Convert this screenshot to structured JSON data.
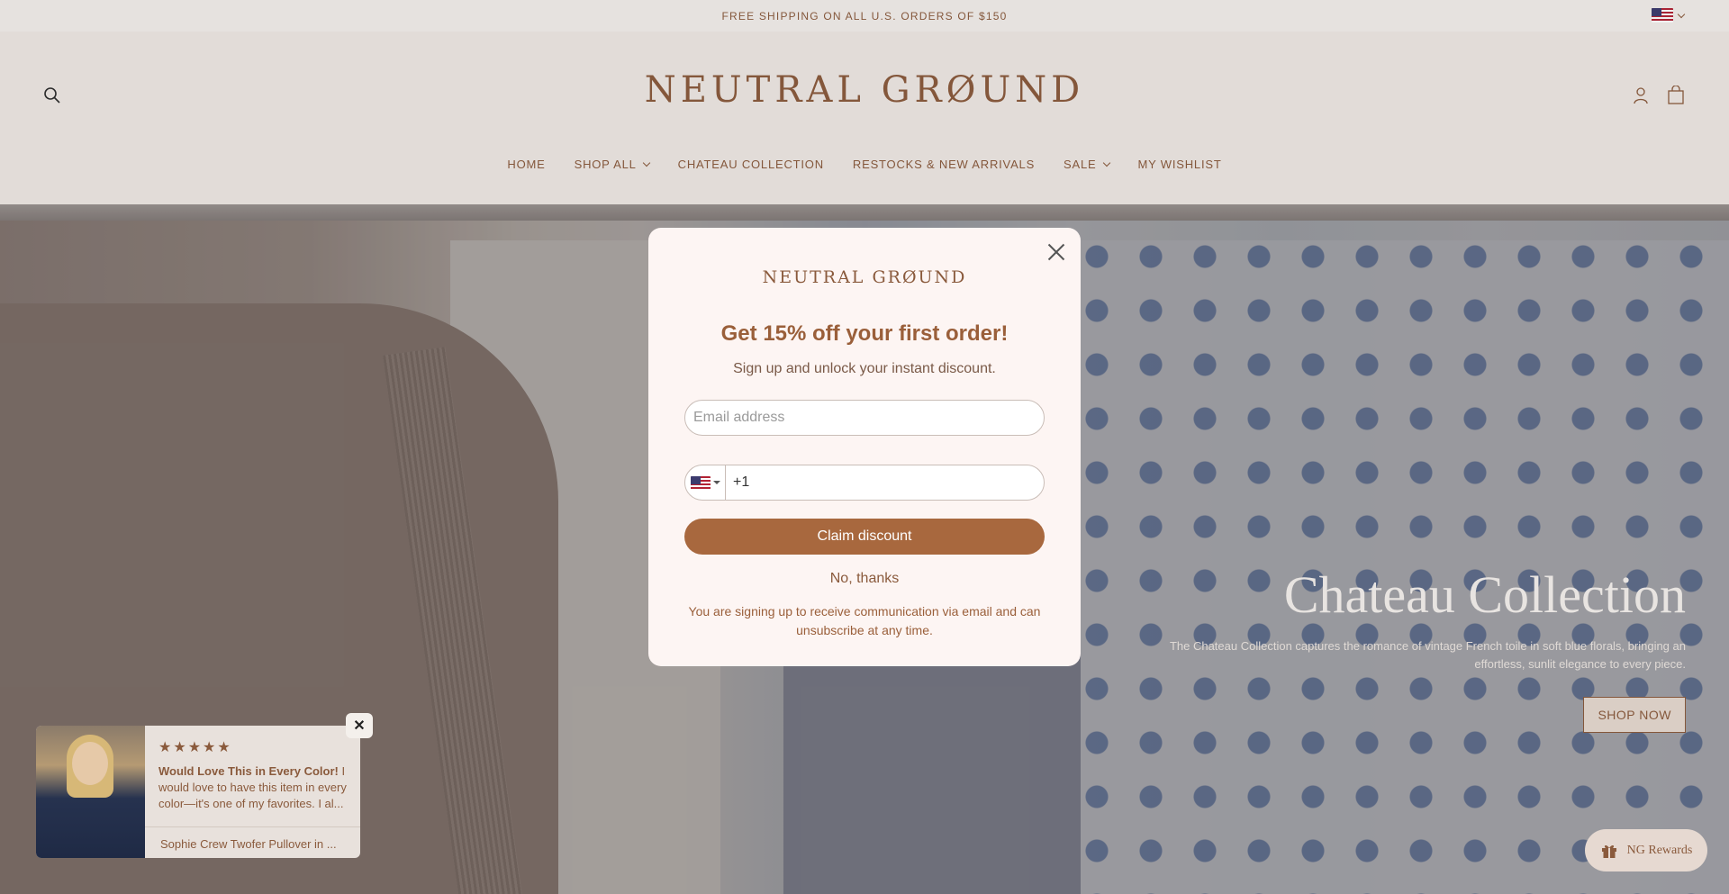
{
  "announcement": {
    "text": "FREE SHIPPING ON ALL U.S. ORDERS OF $150"
  },
  "header": {
    "logo": "NEUTRAL GRØUND",
    "nav": [
      {
        "label": "HOME"
      },
      {
        "label": "SHOP ALL"
      },
      {
        "label": "CHATEAU COLLECTION"
      },
      {
        "label": "RESTOCKS & NEW ARRIVALS"
      },
      {
        "label": "SALE"
      },
      {
        "label": "MY WISHLIST"
      }
    ],
    "icons": [
      "search-icon",
      "account-icon",
      "cart-icon",
      "us-flag-icon"
    ]
  },
  "hero": {
    "title": "Chateau Collection",
    "description": "The Chateau Collection captures the romance of vintage French toile in soft blue florals, bringing an effortless, sunlit elegance to every piece.",
    "button": "SHOP NOW"
  },
  "modal": {
    "logo": "NEUTRAL GRØUND",
    "title": "Get 15% off your first order!",
    "subtitle": "Sign up and unlock your instant discount.",
    "email_placeholder": "Email address",
    "phone_value": "+1",
    "claim_button": "Claim discount",
    "no_thanks": "No, thanks",
    "disclaimer": "You are signing up to receive communication via email and can unsubscribe at any time."
  },
  "review": {
    "stars": "★★★★★",
    "rating": 5,
    "headline": "Would Love This in Every Color!",
    "body": " I would love to have this item in every color—it's one of my favorites. I al...",
    "product": "Sophie Crew Twofer Pullover in ...",
    "close": "✕"
  },
  "rewards": {
    "label": "NG Rewards"
  },
  "colors": {
    "accent": "#a8683e",
    "text": "#8a5a3c",
    "modal_bg": "#fdf5f3"
  }
}
